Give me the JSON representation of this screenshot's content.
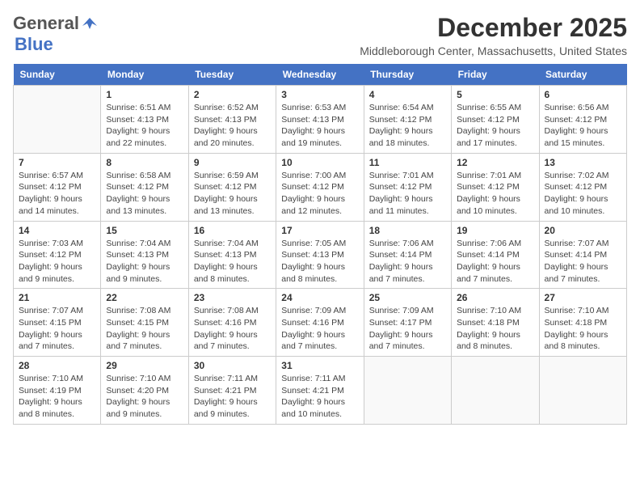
{
  "logo": {
    "general": "General",
    "blue": "Blue"
  },
  "title": "December 2025",
  "location": "Middleborough Center, Massachusetts, United States",
  "weekdays": [
    "Sunday",
    "Monday",
    "Tuesday",
    "Wednesday",
    "Thursday",
    "Friday",
    "Saturday"
  ],
  "weeks": [
    [
      {
        "day": "",
        "info": ""
      },
      {
        "day": "1",
        "info": "Sunrise: 6:51 AM\nSunset: 4:13 PM\nDaylight: 9 hours\nand 22 minutes."
      },
      {
        "day": "2",
        "info": "Sunrise: 6:52 AM\nSunset: 4:13 PM\nDaylight: 9 hours\nand 20 minutes."
      },
      {
        "day": "3",
        "info": "Sunrise: 6:53 AM\nSunset: 4:13 PM\nDaylight: 9 hours\nand 19 minutes."
      },
      {
        "day": "4",
        "info": "Sunrise: 6:54 AM\nSunset: 4:12 PM\nDaylight: 9 hours\nand 18 minutes."
      },
      {
        "day": "5",
        "info": "Sunrise: 6:55 AM\nSunset: 4:12 PM\nDaylight: 9 hours\nand 17 minutes."
      },
      {
        "day": "6",
        "info": "Sunrise: 6:56 AM\nSunset: 4:12 PM\nDaylight: 9 hours\nand 15 minutes."
      }
    ],
    [
      {
        "day": "7",
        "info": "Sunrise: 6:57 AM\nSunset: 4:12 PM\nDaylight: 9 hours\nand 14 minutes."
      },
      {
        "day": "8",
        "info": "Sunrise: 6:58 AM\nSunset: 4:12 PM\nDaylight: 9 hours\nand 13 minutes."
      },
      {
        "day": "9",
        "info": "Sunrise: 6:59 AM\nSunset: 4:12 PM\nDaylight: 9 hours\nand 13 minutes."
      },
      {
        "day": "10",
        "info": "Sunrise: 7:00 AM\nSunset: 4:12 PM\nDaylight: 9 hours\nand 12 minutes."
      },
      {
        "day": "11",
        "info": "Sunrise: 7:01 AM\nSunset: 4:12 PM\nDaylight: 9 hours\nand 11 minutes."
      },
      {
        "day": "12",
        "info": "Sunrise: 7:01 AM\nSunset: 4:12 PM\nDaylight: 9 hours\nand 10 minutes."
      },
      {
        "day": "13",
        "info": "Sunrise: 7:02 AM\nSunset: 4:12 PM\nDaylight: 9 hours\nand 10 minutes."
      }
    ],
    [
      {
        "day": "14",
        "info": "Sunrise: 7:03 AM\nSunset: 4:12 PM\nDaylight: 9 hours\nand 9 minutes."
      },
      {
        "day": "15",
        "info": "Sunrise: 7:04 AM\nSunset: 4:13 PM\nDaylight: 9 hours\nand 9 minutes."
      },
      {
        "day": "16",
        "info": "Sunrise: 7:04 AM\nSunset: 4:13 PM\nDaylight: 9 hours\nand 8 minutes."
      },
      {
        "day": "17",
        "info": "Sunrise: 7:05 AM\nSunset: 4:13 PM\nDaylight: 9 hours\nand 8 minutes."
      },
      {
        "day": "18",
        "info": "Sunrise: 7:06 AM\nSunset: 4:14 PM\nDaylight: 9 hours\nand 7 minutes."
      },
      {
        "day": "19",
        "info": "Sunrise: 7:06 AM\nSunset: 4:14 PM\nDaylight: 9 hours\nand 7 minutes."
      },
      {
        "day": "20",
        "info": "Sunrise: 7:07 AM\nSunset: 4:14 PM\nDaylight: 9 hours\nand 7 minutes."
      }
    ],
    [
      {
        "day": "21",
        "info": "Sunrise: 7:07 AM\nSunset: 4:15 PM\nDaylight: 9 hours\nand 7 minutes."
      },
      {
        "day": "22",
        "info": "Sunrise: 7:08 AM\nSunset: 4:15 PM\nDaylight: 9 hours\nand 7 minutes."
      },
      {
        "day": "23",
        "info": "Sunrise: 7:08 AM\nSunset: 4:16 PM\nDaylight: 9 hours\nand 7 minutes."
      },
      {
        "day": "24",
        "info": "Sunrise: 7:09 AM\nSunset: 4:16 PM\nDaylight: 9 hours\nand 7 minutes."
      },
      {
        "day": "25",
        "info": "Sunrise: 7:09 AM\nSunset: 4:17 PM\nDaylight: 9 hours\nand 7 minutes."
      },
      {
        "day": "26",
        "info": "Sunrise: 7:10 AM\nSunset: 4:18 PM\nDaylight: 9 hours\nand 8 minutes."
      },
      {
        "day": "27",
        "info": "Sunrise: 7:10 AM\nSunset: 4:18 PM\nDaylight: 9 hours\nand 8 minutes."
      }
    ],
    [
      {
        "day": "28",
        "info": "Sunrise: 7:10 AM\nSunset: 4:19 PM\nDaylight: 9 hours\nand 8 minutes."
      },
      {
        "day": "29",
        "info": "Sunrise: 7:10 AM\nSunset: 4:20 PM\nDaylight: 9 hours\nand 9 minutes."
      },
      {
        "day": "30",
        "info": "Sunrise: 7:11 AM\nSunset: 4:21 PM\nDaylight: 9 hours\nand 9 minutes."
      },
      {
        "day": "31",
        "info": "Sunrise: 7:11 AM\nSunset: 4:21 PM\nDaylight: 9 hours\nand 10 minutes."
      },
      {
        "day": "",
        "info": ""
      },
      {
        "day": "",
        "info": ""
      },
      {
        "day": "",
        "info": ""
      }
    ]
  ]
}
